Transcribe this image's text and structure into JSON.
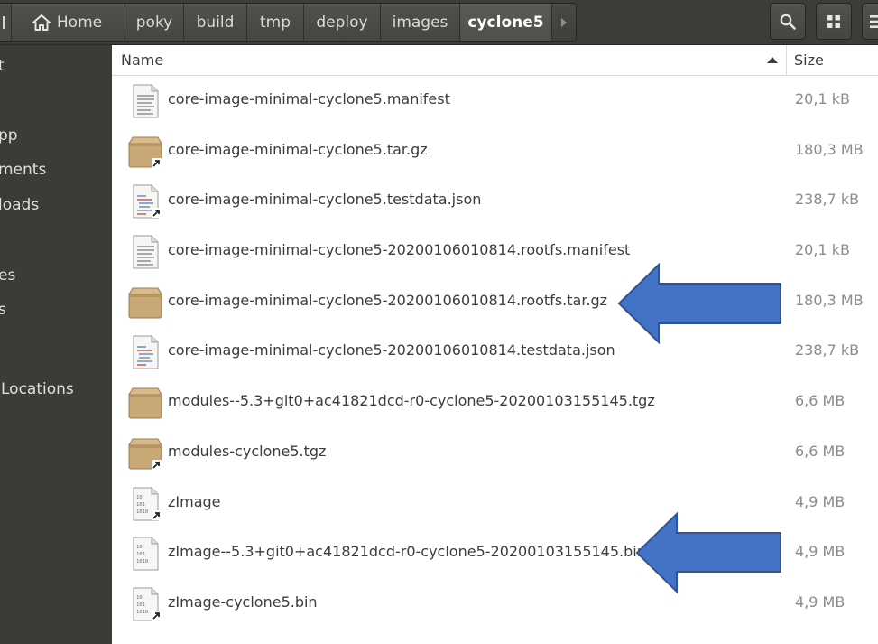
{
  "pathbar": {
    "crumbs": [
      "Home",
      "poky",
      "build",
      "tmp",
      "deploy",
      "images",
      "cyclone5"
    ],
    "active_index": 6
  },
  "toolbar": {
    "search_icon": "search-icon",
    "view_icon": "grid-view-icon",
    "menu_icon": "menu-icon"
  },
  "sidebar": {
    "items": [
      "t",
      "pp",
      "ments",
      "loads",
      "es",
      "s",
      "Locations"
    ]
  },
  "columns": {
    "name": "Name",
    "size": "Size",
    "sort": "ascending"
  },
  "files": [
    {
      "name": "core-image-minimal-cyclone5.manifest",
      "size": "20,1 kB",
      "type": "text"
    },
    {
      "name": "core-image-minimal-cyclone5.tar.gz",
      "size": "180,3 MB",
      "type": "archive-link"
    },
    {
      "name": "core-image-minimal-cyclone5.testdata.json",
      "size": "238,7 kB",
      "type": "json-link"
    },
    {
      "name": "core-image-minimal-cyclone5-20200106010814.rootfs.manifest",
      "size": "20,1 kB",
      "type": "text"
    },
    {
      "name": "core-image-minimal-cyclone5-20200106010814.rootfs.tar.gz",
      "size": "180,3 MB",
      "type": "archive"
    },
    {
      "name": "core-image-minimal-cyclone5-20200106010814.testdata.json",
      "size": "238,7 kB",
      "type": "json"
    },
    {
      "name": "modules--5.3+git0+ac41821dcd-r0-cyclone5-20200103155145.tgz",
      "size": "6,6 MB",
      "type": "archive"
    },
    {
      "name": "modules-cyclone5.tgz",
      "size": "6,6 MB",
      "type": "archive-link"
    },
    {
      "name": "zImage",
      "size": "4,9 MB",
      "type": "binary-link"
    },
    {
      "name": "zImage--5.3+git0+ac41821dcd-r0-cyclone5-20200103155145.bin",
      "size": "4,9 MB",
      "type": "binary"
    },
    {
      "name": "zImage-cyclone5.bin",
      "size": "4,9 MB",
      "type": "binary-link"
    }
  ],
  "annotations": {
    "arrow_color": "#4472c4",
    "pointed_rows": [
      4,
      9
    ]
  }
}
